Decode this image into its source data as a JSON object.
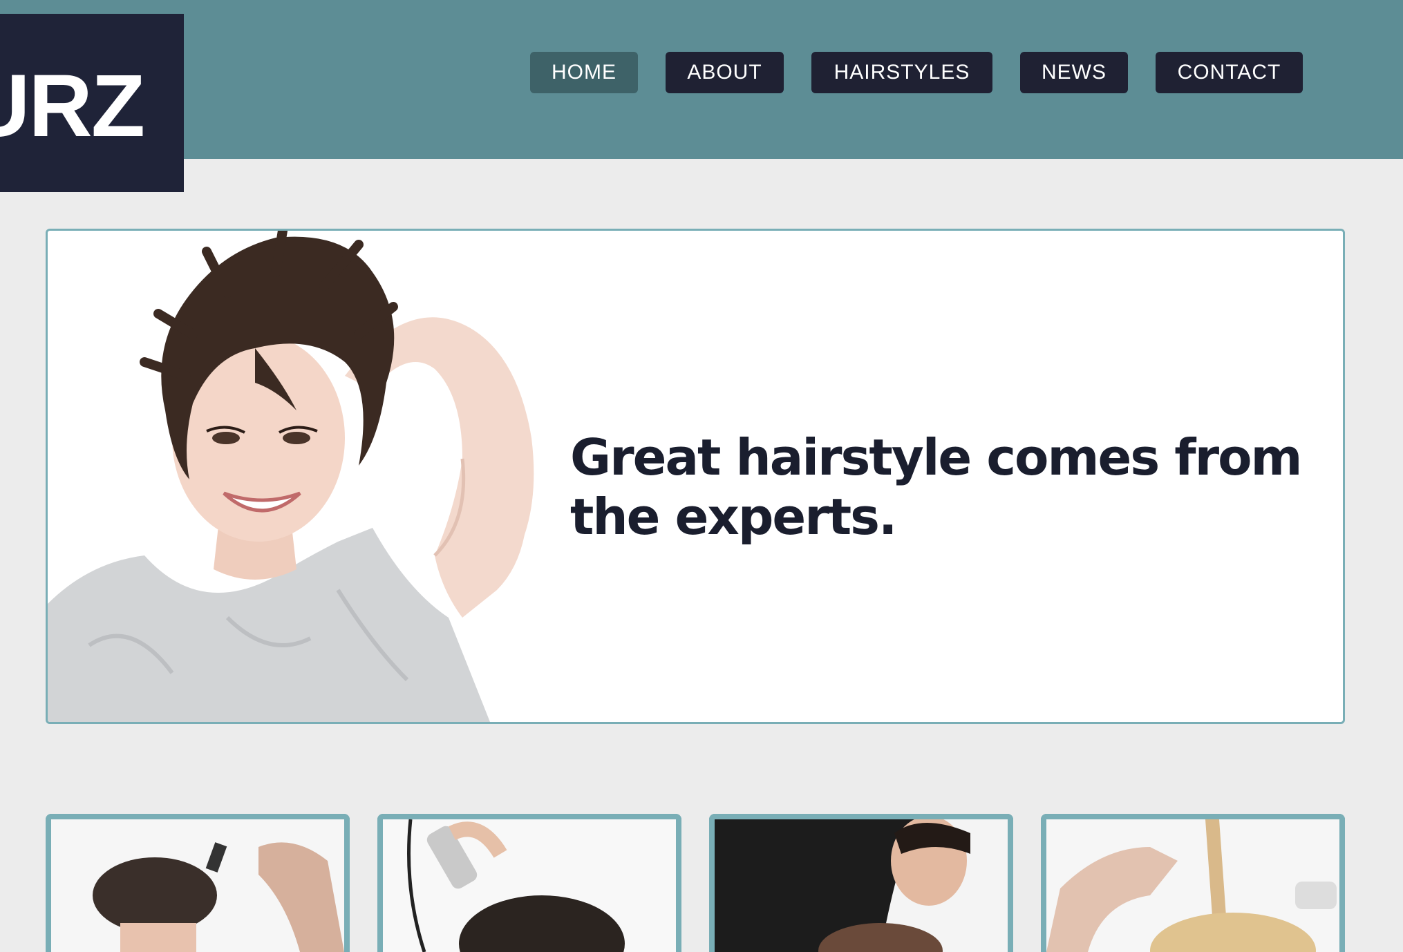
{
  "header": {
    "logo_text": "URZ",
    "nav": {
      "home": "HOME",
      "about": "ABOUT",
      "hairstyles": "HAIRSTYLES",
      "news": "NEWS",
      "contact": "CONTACT"
    }
  },
  "hero": {
    "headline": "Great hairstyle comes from the experts."
  },
  "colors": {
    "header_bg": "#5d8d95",
    "logo_bg": "#1f2338",
    "nav_bg": "#1f2133",
    "nav_active_bg": "#3e6268",
    "frame_border": "#79aeb6",
    "page_bg": "#ececec",
    "headline": "#1a1e2e"
  }
}
